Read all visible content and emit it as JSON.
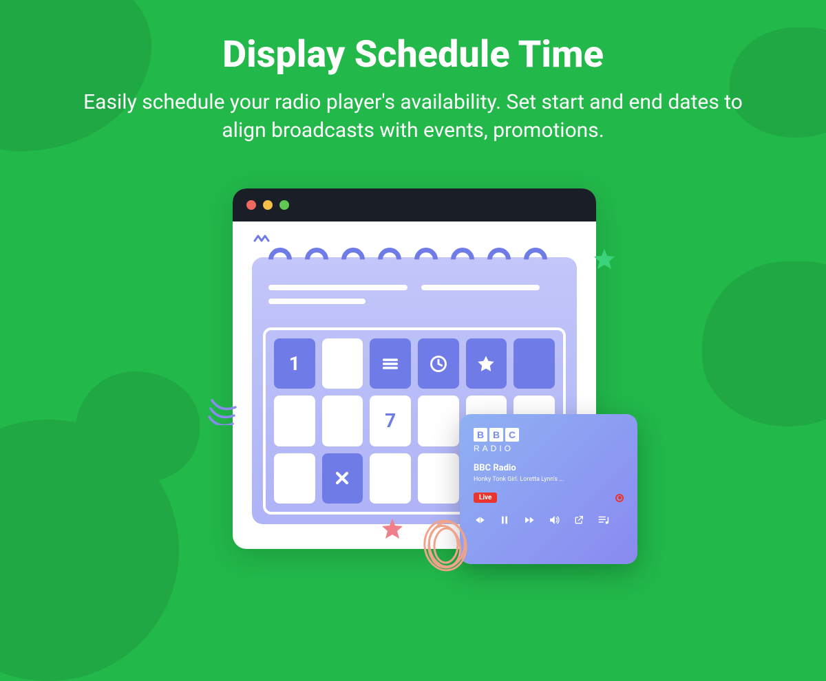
{
  "header": {
    "title": "Display Schedule Time",
    "subtitle": "Easily schedule your radio player's availability. Set start and end dates to align broadcasts with events, promotions."
  },
  "calendar": {
    "cells": {
      "day1": "1",
      "day7": "7"
    }
  },
  "player": {
    "logo_letters": [
      "B",
      "B",
      "C"
    ],
    "logo_sub": "RADIO",
    "station": "BBC Radio",
    "track": "Honky Tonk Girl. Loretta Lynn's ...",
    "live_label": "Live"
  }
}
